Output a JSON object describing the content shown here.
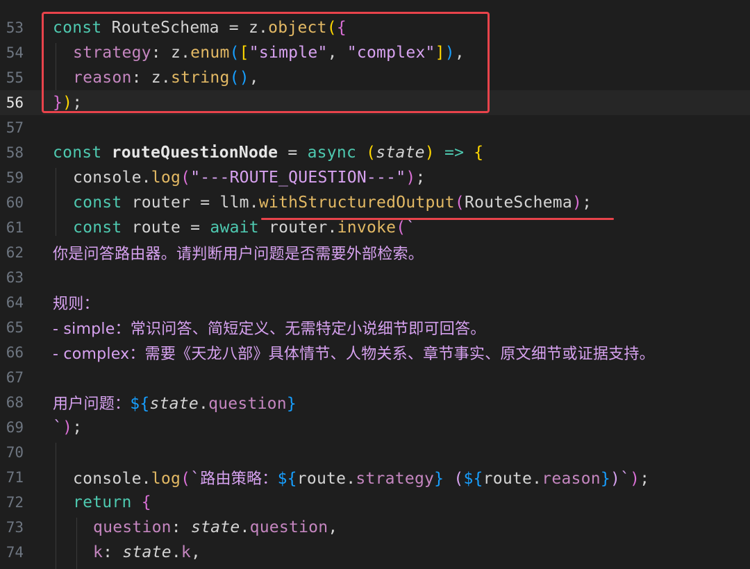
{
  "editor": {
    "current_line": "56",
    "lines": [
      {
        "num": "53",
        "text": "const RouteSchema = z.object({"
      },
      {
        "num": "54",
        "text": "  strategy: z.enum([\"simple\", \"complex\"]),"
      },
      {
        "num": "55",
        "text": "  reason: z.string(),"
      },
      {
        "num": "56",
        "text": "});"
      },
      {
        "num": "57",
        "text": ""
      },
      {
        "num": "58",
        "text": "const routeQuestionNode = async (state) => {"
      },
      {
        "num": "59",
        "text": "  console.log(\"---ROUTE_QUESTION---\");"
      },
      {
        "num": "60",
        "text": "  const router = llm.withStructuredOutput(RouteSchema);"
      },
      {
        "num": "61",
        "text": "  const route = await router.invoke(`"
      },
      {
        "num": "62",
        "text": "你是问答路由器。请判断用户问题是否需要外部检索。"
      },
      {
        "num": "63",
        "text": ""
      },
      {
        "num": "64",
        "text": "规则："
      },
      {
        "num": "65",
        "text": "- simple：常识问答、简短定义、无需特定小说细节即可回答。"
      },
      {
        "num": "66",
        "text": "- complex：需要《天龙八部》具体情节、人物关系、章节事实、原文细节或证据支持。"
      },
      {
        "num": "67",
        "text": ""
      },
      {
        "num": "68",
        "text": "用户问题：${state.question}"
      },
      {
        "num": "69",
        "text": "`);"
      },
      {
        "num": "70",
        "text": ""
      },
      {
        "num": "71",
        "text": "  console.log(`路由策略：${route.strategy} (${route.reason})`);"
      },
      {
        "num": "72",
        "text": "  return {"
      },
      {
        "num": "73",
        "text": "    question: state.question,"
      },
      {
        "num": "74",
        "text": "    k: state.k,"
      }
    ]
  },
  "tokens": {
    "l53": {
      "kw": "const",
      "name": " RouteSchema = z.",
      "fn": "object",
      "b1": "(",
      "b2": "{"
    },
    "l54": {
      "prop": "strategy",
      "mid": ": z.",
      "fn": "enum",
      "b1": "(",
      "b2": "[",
      "s1": "\"simple\"",
      "comma": ", ",
      "s2": "\"complex\"",
      "b3": "]",
      "b4": ")",
      "end": ","
    },
    "l55": {
      "prop": "reason",
      "mid": ": z.",
      "fn": "string",
      "b1": "(",
      "b2": ")",
      "end": ","
    },
    "l56": {
      "b1": "}",
      "b2": ")",
      "end": ";"
    },
    "l58": {
      "kw": "const",
      "sp": " ",
      "name": "routeQuestionNode",
      "eq": " = ",
      "async": "async",
      "sp2": " ",
      "b1": "(",
      "param": "state",
      "b2": ")",
      "arrow": " => ",
      "b3": "{"
    },
    "l59": {
      "obj": "console.",
      "fn": "log",
      "b1": "(",
      "str": "\"---ROUTE_QUESTION---\"",
      "b2": ")",
      "end": ";"
    },
    "l60": {
      "kw": "const",
      "mid": " router = llm.",
      "fn": "withStructuredOutput",
      "b1": "(",
      "arg": "RouteSchema",
      "b2": ")",
      "end": ";"
    },
    "l61": {
      "kw": "const",
      "mid": " route = ",
      "await": "await",
      "mid2": " router.",
      "fn": "invoke",
      "b1": "(",
      "tick": "`"
    },
    "l68": {
      "cn": "用户问题：",
      "d1": "${",
      "v": "state",
      "dot": ".",
      "p": "question",
      "d2": "}"
    },
    "l69": {
      "tick": "`",
      "b1": ")",
      "end": ";"
    },
    "l71": {
      "obj": "console.",
      "fn": "log",
      "b1": "(",
      "tick": "`",
      "cn": "路由策略：",
      "d1": "${",
      "v1": "route.",
      "p1": "strategy",
      "d2": "}",
      "sp": " (",
      "d3": "${",
      "v2": "route.",
      "p2": "reason",
      "d4": "}",
      "cp": ")",
      "tick2": "`",
      "b2": ")",
      "end": ";"
    },
    "l72": {
      "kw": "return",
      "sp": " ",
      "b1": "{"
    },
    "l73": {
      "prop": "question",
      "colon": ": ",
      "v": "state",
      "dot": ".",
      "p": "question",
      "end": ","
    },
    "l74": {
      "prop": "k",
      "colon": ": ",
      "v": "state",
      "dot": ".",
      "p": "k",
      "end": ","
    }
  },
  "colors": {
    "background": "#1e1e1e",
    "highlight_annotation": "#e8434b"
  }
}
